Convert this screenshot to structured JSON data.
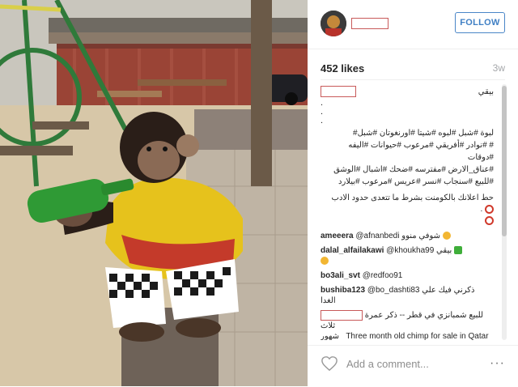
{
  "post": {
    "follow_label": "FOLLOW",
    "likes": "452 likes",
    "age": "3w"
  },
  "caption": {
    "line1": "بيقي",
    "dot": ".",
    "hashtags": [
      "لبوة #شبل #لبوه #شيتا #اورنغوتان #شبل#",
      "# #نوادر #أفريقي #مرعوب #حيوانات #اليفه #دوقات",
      "#عناق_الارض #مفترسه #ضحك #اشبال #الوشق",
      "#للبيع #سنجاب #نسر #عريس #مرعوب #بيلارد"
    ],
    "rules": "حط اعلانك بالكومنت بشرط ما تتعدى حدود الادب",
    "rules_dot": "."
  },
  "comments": [
    {
      "user": "ameeera",
      "text": "@afnanbedi شوفي منوو"
    },
    {
      "user": "dalal_alfailakawi",
      "text": "@khoukha99 بيقي"
    },
    {
      "user": "bo3ali_svt",
      "text": "@redfoo91"
    },
    {
      "user": "bushiba123",
      "text": "@bo_dashti83 ذكرني فيك علي",
      "extra": "الغدا"
    },
    {
      "text": "للبيع شمبانزي في قطر -- ذكر عمرة ثلاث",
      "text2": "شهور",
      "english": "Three month old chimp for sale in Qatar"
    }
  ],
  "footer": {
    "add_comment_placeholder": "Add a comment...",
    "more_label": "···"
  },
  "icons": {
    "heart": "heart-icon",
    "more": "more-options-icon"
  },
  "colors": {
    "follow_blue": "#3f7fc4",
    "redaction_red": "#c85a5a",
    "muted_gray": "#8e8e8e"
  }
}
